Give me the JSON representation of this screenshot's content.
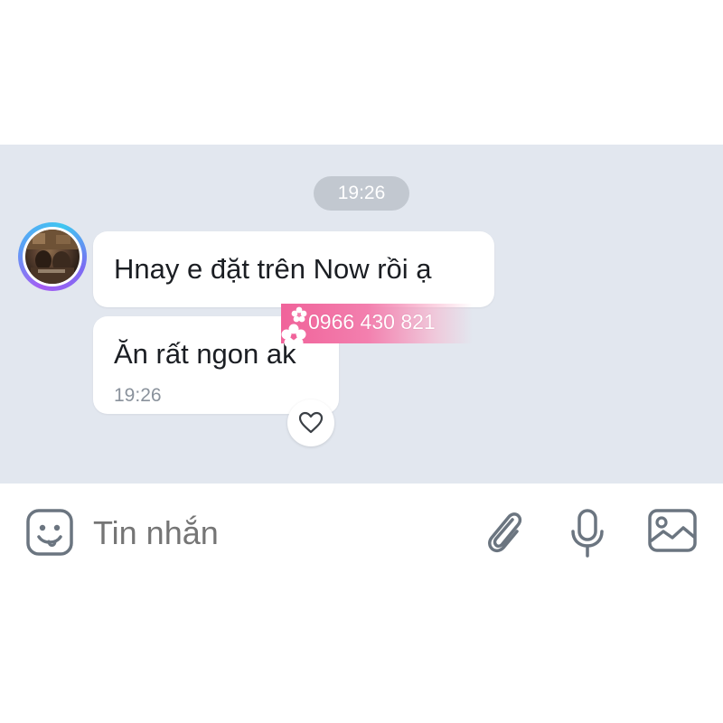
{
  "chat": {
    "timestamp_divider": "19:26",
    "messages": [
      {
        "text": "Hnay e đặt trên Now rồi ạ"
      },
      {
        "text": "Ăn rất ngon ak",
        "time": "19:26"
      }
    ]
  },
  "watermark": {
    "text": "0966 430 821"
  },
  "input": {
    "placeholder": "Tin nhắn"
  },
  "icons": {
    "emoji": "emoji-sticker-icon",
    "attach": "paperclip-icon",
    "mic": "microphone-icon",
    "image": "image-icon",
    "react": "heart-icon"
  },
  "colors": {
    "chat_background": "#e2e7ef",
    "bubble": "#ffffff",
    "watermark_pink": "#f0639a",
    "icon_gray": "#6b7580"
  }
}
